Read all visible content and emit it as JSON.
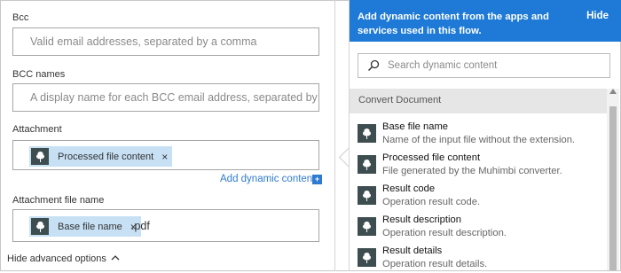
{
  "form": {
    "bcc": {
      "label": "Bcc",
      "placeholder": "Valid email addresses, separated by a comma"
    },
    "bcc_names": {
      "label": "BCC names",
      "placeholder": "A display name for each BCC email address, separated by a"
    },
    "attachment": {
      "label": "Attachment",
      "token": "Processed file content",
      "token_remove": "×"
    },
    "add_dynamic": {
      "label": "Add dynamic content",
      "icon": "+"
    },
    "attachment_file_name": {
      "label": "Attachment file name",
      "token": "Base file name",
      "token_remove": "×",
      "suffix": ".pdf"
    },
    "hide_advanced": {
      "label": "Hide advanced options",
      "icon": "chevron-up-icon"
    }
  },
  "panel": {
    "title": "Add dynamic content from the apps and services used in this flow.",
    "hide_label": "Hide",
    "search_placeholder": "Search dynamic content",
    "group_title": "Convert Document",
    "items": [
      {
        "title": "Base file name",
        "desc": "Name of the input file without the extension."
      },
      {
        "title": "Processed file content",
        "desc": "File generated by the Muhimbi converter."
      },
      {
        "title": "Result code",
        "desc": "Operation result code."
      },
      {
        "title": "Result description",
        "desc": "Operation result description."
      },
      {
        "title": "Result details",
        "desc": "Operation result details."
      }
    ]
  },
  "colors": {
    "accent": "#1e7ad6",
    "token_bg": "#c7e0f4",
    "icon_bg": "#3e4e50",
    "link": "#2f7bd1"
  }
}
